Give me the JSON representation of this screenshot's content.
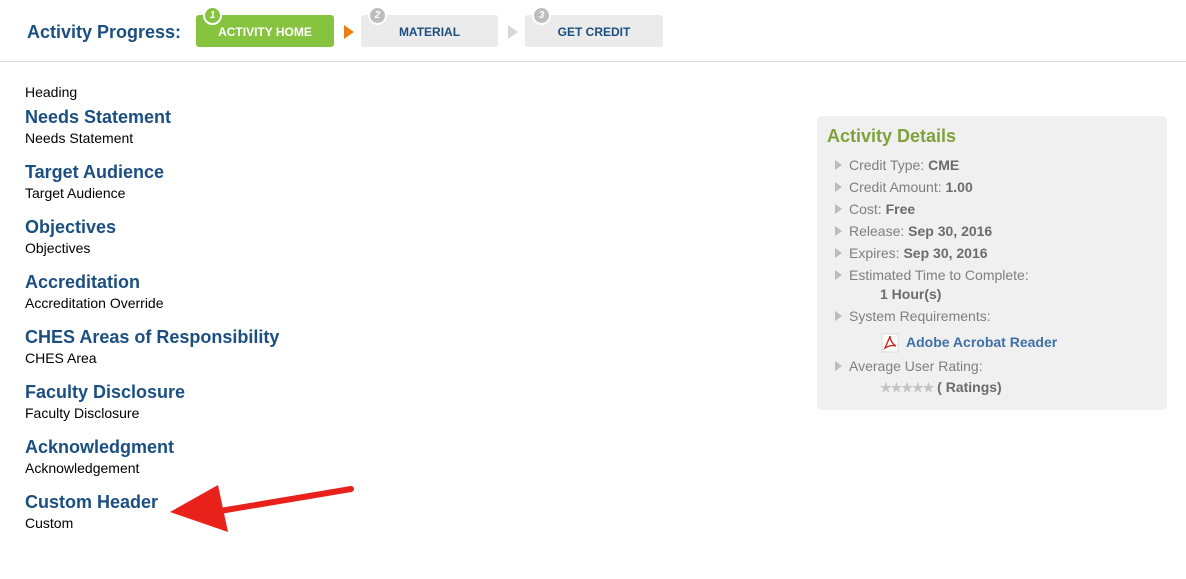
{
  "progress": {
    "label": "Activity Progress:",
    "steps": [
      {
        "num": "1",
        "label": "ACTIVITY HOME"
      },
      {
        "num": "2",
        "label": "MATERIAL"
      },
      {
        "num": "3",
        "label": "GET CREDIT"
      }
    ]
  },
  "main": {
    "heading": "Heading",
    "sections": [
      {
        "title": "Needs Statement",
        "text": "Needs Statement"
      },
      {
        "title": "Target Audience",
        "text": "Target Audience"
      },
      {
        "title": "Objectives",
        "text": "Objectives"
      },
      {
        "title": "Accreditation",
        "text": "Accreditation Override"
      },
      {
        "title": "CHES Areas of Responsibility",
        "text": "CHES Area"
      },
      {
        "title": "Faculty Disclosure",
        "text": "Faculty Disclosure"
      },
      {
        "title": "Acknowledgment",
        "text": "Acknowledgement"
      },
      {
        "title": "Custom Header",
        "text": "Custom"
      }
    ]
  },
  "details": {
    "title": "Activity Details",
    "credit_type_label": "Credit Type:",
    "credit_type": "CME",
    "credit_amount_label": "Credit Amount:",
    "credit_amount": "1.00",
    "cost_label": "Cost:",
    "cost": "Free",
    "release_label": "Release:",
    "release": "Sep 30, 2016",
    "expires_label": "Expires:",
    "expires": "Sep 30, 2016",
    "time_label": "Estimated Time to Complete:",
    "time": "1 Hour(s)",
    "requirements_label": "System Requirements:",
    "acrobat": "Adobe Acrobat Reader",
    "rating_label": "Average User Rating:",
    "stars": "★★★★★",
    "ratings": "( Ratings)"
  },
  "colors": {
    "brand_blue": "#1b4f82",
    "active_green": "#86c43f",
    "arrow_orange": "#f07d1c",
    "annotation_red": "#e8221b"
  }
}
